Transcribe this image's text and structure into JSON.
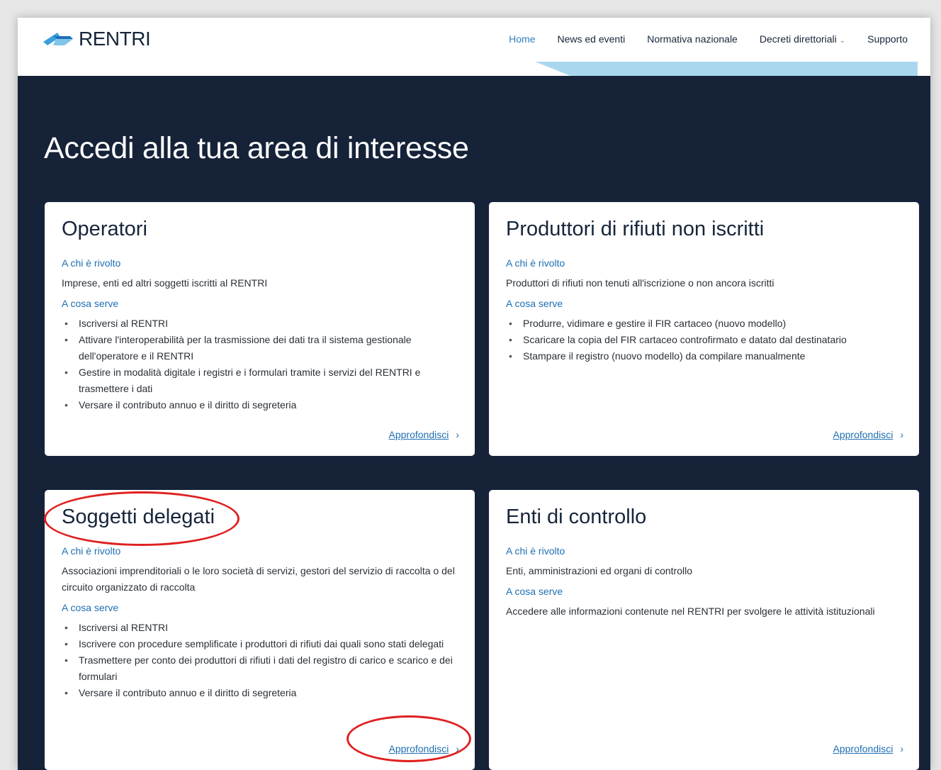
{
  "brand": {
    "name": "RENTRI"
  },
  "nav": {
    "items": [
      {
        "label": "Home",
        "active": true
      },
      {
        "label": "News ed eventi"
      },
      {
        "label": "Normativa nazionale"
      },
      {
        "label": "Decreti direttoriali",
        "chevron": "⌄"
      },
      {
        "label": "Supporto"
      }
    ]
  },
  "hero": {
    "title": "Accedi alla tua area di interesse"
  },
  "cards": [
    {
      "title": "Operatori",
      "who_label": "A chi è rivolto",
      "who_text": "Imprese, enti ed altri soggetti iscritti al RENTRI",
      "what_label": "A cosa serve",
      "bullets": [
        "Iscriversi al RENTRI",
        "Attivare l'interoperabilità per la trasmissione dei dati tra il sistema gestionale dell'operatore e il RENTRI",
        "Gestire in modalità digitale i registri e i formulari tramite i servizi del RENTRI e trasmettere i dati",
        "Versare il contributo annuo e il diritto di segreteria"
      ],
      "more": "Approfondisci",
      "arrow": "›"
    },
    {
      "title": "Produttori di rifiuti non iscritti",
      "who_label": "A chi è rivolto",
      "who_text": "Produttori di rifiuti non tenuti all'iscrizione o non ancora iscritti",
      "what_label": "A cosa serve",
      "bullets": [
        "Produrre, vidimare e gestire il FIR cartaceo (nuovo modello)",
        "Scaricare la copia del FIR cartaceo controfirmato e datato dal destinatario",
        "Stampare il registro (nuovo modello) da compilare manualmente"
      ],
      "more": "Approfondisci",
      "arrow": "›"
    },
    {
      "title": "Soggetti delegati",
      "who_label": "A chi è rivolto",
      "who_text": "Associazioni imprenditoriali o le loro società di servizi, gestori del servizio di raccolta o del circuito organizzato di raccolta",
      "what_label": "A cosa serve",
      "bullets": [
        "Iscriversi al RENTRI",
        "Iscrivere con procedure semplificate i produttori di rifiuti dai quali sono stati delegati",
        "Trasmettere per conto dei produttori di rifiuti i dati del registro di carico e scarico e dei formulari",
        "Versare il contributo annuo e il diritto di segreteria"
      ],
      "more": "Approfondisci",
      "arrow": "›"
    },
    {
      "title": "Enti di controllo",
      "who_label": "A chi è rivolto",
      "who_text": "Enti, amministrazioni ed organi di controllo",
      "what_label": "A cosa serve",
      "what_text": "Accedere alle informazioni contenute nel RENTRI per svolgere le attività istituzionali",
      "more": "Approfondisci",
      "arrow": "›"
    }
  ],
  "colors": {
    "dark_bg": "#152238",
    "accent": "#1f6fb2",
    "highlight": "#e02020"
  }
}
